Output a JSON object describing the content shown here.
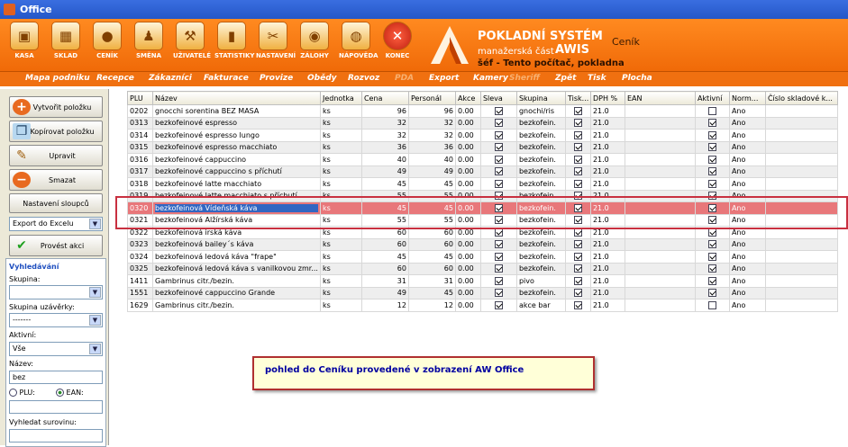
{
  "window": {
    "title": "Office"
  },
  "toolbar": [
    {
      "label": "KASA",
      "icon": "cash-register-icon",
      "glyph": "▣"
    },
    {
      "label": "SKLAD",
      "icon": "warehouse-icon",
      "glyph": "▦"
    },
    {
      "label": "CENÍK",
      "icon": "price-list-icon",
      "glyph": "●"
    },
    {
      "label": "SMĚNA",
      "icon": "shift-icon",
      "glyph": "♟"
    },
    {
      "label": "UŽIVATELÉ",
      "icon": "users-icon",
      "glyph": "⚒"
    },
    {
      "label": "STATISTIKY",
      "icon": "statistics-icon",
      "glyph": "▮"
    },
    {
      "label": "NASTAVENÍ",
      "icon": "settings-icon",
      "glyph": "✂"
    },
    {
      "label": "ZÁLOHY",
      "icon": "backup-disc-icon",
      "glyph": "◉"
    },
    {
      "label": "NÁPOVĚDA",
      "icon": "help-globe-icon",
      "glyph": "◍"
    },
    {
      "label": "KONEC",
      "icon": "exit-icon",
      "glyph": "✕"
    }
  ],
  "brand": {
    "line1": "POKLADNÍ SYSTÉM",
    "line2": "manažerská část",
    "line3": "AWIS",
    "line4": "šéf  -  Tento počítač, pokladna",
    "section": "Ceník"
  },
  "menu": [
    "Mapa podniku",
    "Recepce",
    "Zákazníci",
    "Fakturace",
    "Provize",
    "Obědy",
    "Rozvoz",
    "PDA",
    "Export",
    "Kamery",
    "Sheriff",
    "Zpět",
    "Tisk",
    "Plocha"
  ],
  "sidebar": {
    "create": "Vytvořit položku",
    "copy": "Kopírovat položku",
    "edit": "Upravit",
    "delete": "Smazat",
    "columns": "Nastavení sloupců",
    "export": "Export do Excelu",
    "run": "Provést akci",
    "search_title": "Vyhledávání",
    "group": "Skupina:",
    "group_val": "",
    "closure": "Skupina uzávěrky:",
    "closure_val": "-------",
    "active": "Aktivní:",
    "active_val": "Vše",
    "name": "Název:",
    "name_val": "bez",
    "plu": "PLU:",
    "ean": "EAN:",
    "code_val": "",
    "material": "Vyhledat surovinu:"
  },
  "table": {
    "headers": [
      "PLU",
      "Název",
      "Jednotka",
      "Cena",
      "Personál",
      "Akce",
      "Sleva",
      "Skupina",
      "Tisk...",
      "DPH %",
      "EAN",
      "Aktivní",
      "Norm...",
      "Číslo skladové k..."
    ],
    "rows": [
      {
        "plu": "0202",
        "name": "gnocchi sorentina BEZ MASA",
        "unit": "ks",
        "price": "96",
        "staff": "96",
        "action": "0.00",
        "disc": true,
        "group": "gnochi/ris",
        "print": true,
        "vat": "21.0",
        "active": false,
        "norm": "Ano"
      },
      {
        "plu": "0313",
        "name": "bezkofeinové espresso",
        "unit": "ks",
        "price": "32",
        "staff": "32",
        "action": "0.00",
        "disc": true,
        "group": "bezkofein.",
        "print": true,
        "vat": "21.0",
        "active": true,
        "norm": "Ano"
      },
      {
        "plu": "0314",
        "name": "bezkofeinové espresso lungo",
        "unit": "ks",
        "price": "32",
        "staff": "32",
        "action": "0.00",
        "disc": true,
        "group": "bezkofein.",
        "print": true,
        "vat": "21.0",
        "active": true,
        "norm": "Ano"
      },
      {
        "plu": "0315",
        "name": "bezkofeinové espresso macchiato",
        "unit": "ks",
        "price": "36",
        "staff": "36",
        "action": "0.00",
        "disc": true,
        "group": "bezkofein.",
        "print": true,
        "vat": "21.0",
        "active": true,
        "norm": "Ano"
      },
      {
        "plu": "0316",
        "name": "bezkofeinové cappuccino",
        "unit": "ks",
        "price": "40",
        "staff": "40",
        "action": "0.00",
        "disc": true,
        "group": "bezkofein.",
        "print": true,
        "vat": "21.0",
        "active": true,
        "norm": "Ano"
      },
      {
        "plu": "0317",
        "name": "bezkofeinové cappuccino s příchutí",
        "unit": "ks",
        "price": "49",
        "staff": "49",
        "action": "0.00",
        "disc": true,
        "group": "bezkofein.",
        "print": true,
        "vat": "21.0",
        "active": true,
        "norm": "Ano"
      },
      {
        "plu": "0318",
        "name": "bezkofeinové latte macchiato",
        "unit": "ks",
        "price": "45",
        "staff": "45",
        "action": "0.00",
        "disc": true,
        "group": "bezkofein.",
        "print": true,
        "vat": "21.0",
        "active": true,
        "norm": "Ano"
      },
      {
        "plu": "0319",
        "name": "bezkofeinové latte macchiato s příchutí",
        "unit": "ks",
        "price": "55",
        "staff": "55",
        "action": "0.00",
        "disc": true,
        "group": "bezkofein.",
        "print": true,
        "vat": "21.0",
        "active": true,
        "norm": "Ano"
      },
      {
        "plu": "0320",
        "name": "bezkofeinová Vídeňská káva",
        "unit": "ks",
        "price": "45",
        "staff": "45",
        "action": "0.00",
        "disc": true,
        "group": "bezkofein.",
        "print": true,
        "vat": "21.0",
        "active": true,
        "norm": "Ano"
      },
      {
        "plu": "0321",
        "name": "bezkofeinová Alžírská káva",
        "unit": "ks",
        "price": "55",
        "staff": "55",
        "action": "0.00",
        "disc": true,
        "group": "bezkofein.",
        "print": true,
        "vat": "21.0",
        "active": true,
        "norm": "Ano"
      },
      {
        "plu": "0322",
        "name": "bezkofeinová irská káva",
        "unit": "ks",
        "price": "60",
        "staff": "60",
        "action": "0.00",
        "disc": true,
        "group": "bezkofein.",
        "print": true,
        "vat": "21.0",
        "active": true,
        "norm": "Ano"
      },
      {
        "plu": "0323",
        "name": "bezkofeinová bailey´s káva",
        "unit": "ks",
        "price": "60",
        "staff": "60",
        "action": "0.00",
        "disc": true,
        "group": "bezkofein.",
        "print": true,
        "vat": "21.0",
        "active": true,
        "norm": "Ano"
      },
      {
        "plu": "0324",
        "name": "bezkofeinová ledová káva \"frape\"",
        "unit": "ks",
        "price": "45",
        "staff": "45",
        "action": "0.00",
        "disc": true,
        "group": "bezkofein.",
        "print": true,
        "vat": "21.0",
        "active": true,
        "norm": "Ano"
      },
      {
        "plu": "0325",
        "name": "bezkofeinová ledová káva s vanilkovou zmr...",
        "unit": "ks",
        "price": "60",
        "staff": "60",
        "action": "0.00",
        "disc": true,
        "group": "bezkofein.",
        "print": true,
        "vat": "21.0",
        "active": true,
        "norm": "Ano"
      },
      {
        "plu": "1411",
        "name": "Gambrinus citr./bezin.",
        "unit": "ks",
        "price": "31",
        "staff": "31",
        "action": "0.00",
        "disc": true,
        "group": "pivo",
        "print": true,
        "vat": "21.0",
        "active": true,
        "norm": "Ano"
      },
      {
        "plu": "1551",
        "name": "bezkofeinové cappuccino Grande",
        "unit": "ks",
        "price": "49",
        "staff": "45",
        "action": "0.00",
        "disc": true,
        "group": "bezkofein.",
        "print": true,
        "vat": "21.0",
        "active": true,
        "norm": "Ano"
      },
      {
        "plu": "1629",
        "name": "Gambrinus citr./bezin.",
        "unit": "ks",
        "price": "12",
        "staff": "12",
        "action": "0.00",
        "disc": true,
        "group": "akce bar",
        "print": true,
        "vat": "21.0",
        "active": false,
        "norm": "Ano"
      }
    ]
  },
  "callout": "pohled do Ceníku provedené v zobrazení AW Office",
  "colors": {
    "accent": "#f07010",
    "selected_row": "#e8777a",
    "highlight_border": "#c83040"
  }
}
